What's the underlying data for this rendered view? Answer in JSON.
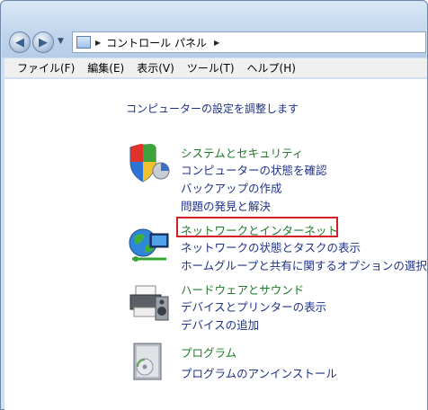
{
  "address_bar": {
    "path": "コントロール パネル"
  },
  "menu": {
    "items": [
      "ファイル(F)",
      "編集(E)",
      "表示(V)",
      "ツール(T)",
      "ヘルプ(H)"
    ]
  },
  "main": {
    "heading": "コンピューターの設定を調整します",
    "categories": [
      {
        "title": "システムとセキュリティ",
        "icon": "shield-icon",
        "links": [
          "コンピューターの状態を確認",
          "バックアップの作成",
          "問題の発見と解決"
        ]
      },
      {
        "title": "ネットワークとインターネット",
        "icon": "network-icon",
        "links": [
          "ネットワークの状態とタスクの表示",
          "ホームグループと共有に関するオプションの選択"
        ]
      },
      {
        "title": "ハードウェアとサウンド",
        "icon": "printer-icon",
        "links": [
          "デバイスとプリンターの表示",
          "デバイスの追加"
        ]
      },
      {
        "title": "プログラム",
        "icon": "programs-icon",
        "links": [
          "プログラムのアンインストール"
        ]
      }
    ]
  },
  "colors": {
    "highlight_border": "#d41f26",
    "category_title": "#1e7b2a",
    "link": "#1e3287"
  }
}
